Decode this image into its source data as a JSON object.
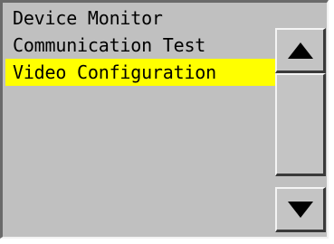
{
  "list": {
    "items": [
      {
        "label": "Device Monitor",
        "selected": false
      },
      {
        "label": "Communication Test",
        "selected": false
      },
      {
        "label": "Video Configuration",
        "selected": true
      }
    ],
    "highlight_color": "#ffff00",
    "background_color": "#c0c0c0"
  },
  "scroll": {
    "up_icon": "triangle-up-icon",
    "down_icon": "triangle-down-icon"
  }
}
